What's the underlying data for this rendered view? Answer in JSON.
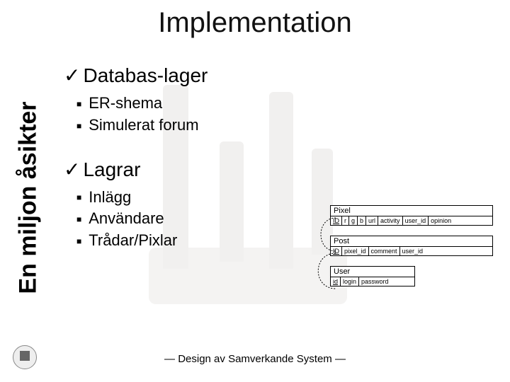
{
  "title": "Implementation",
  "sidebar": "En miljon åsikter",
  "sections": [
    {
      "heading": "Databas-lager",
      "items": [
        "ER-shema",
        "Simulerat forum"
      ]
    },
    {
      "heading": "Lagrar",
      "items": [
        "Inlägg",
        "Användare",
        "Trådar/Pixlar"
      ]
    }
  ],
  "footer": "— Design av Samverkande System —",
  "er": {
    "tables": [
      {
        "name": "Pixel",
        "cols": [
          "ID",
          "r",
          "g",
          "b",
          "url",
          "activity",
          "user_id",
          "opinion"
        ]
      },
      {
        "name": "Post",
        "cols": [
          "ID",
          "pixel_id",
          "comment",
          "user_id"
        ]
      },
      {
        "name": "User",
        "cols": [
          "id",
          "login",
          "password"
        ]
      }
    ]
  }
}
